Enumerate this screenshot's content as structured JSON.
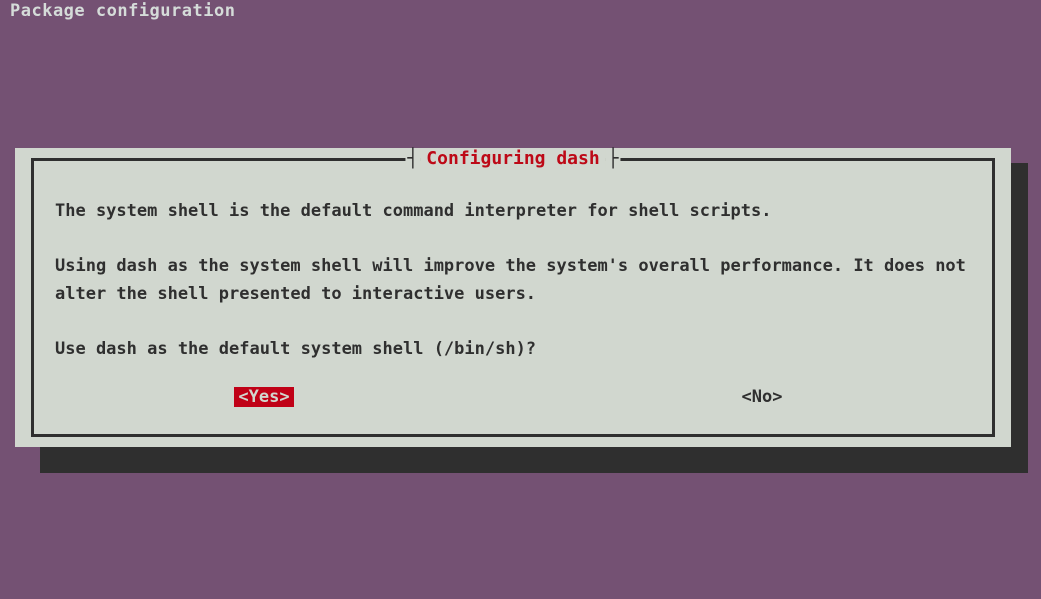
{
  "header": "Package configuration",
  "dialog": {
    "title": "Configuring dash",
    "title_bracket_left": "┤",
    "title_bracket_right": "├",
    "body_line1": "The system shell is the default command interpreter for shell scripts.",
    "body_line2": "Using dash as the system shell will improve the system's overall performance. It does not alter the shell presented to interactive users.",
    "body_line3": "Use dash as the default system shell (/bin/sh)?",
    "buttons": {
      "yes": "<Yes>",
      "no": "<No>",
      "selected": "yes"
    }
  }
}
